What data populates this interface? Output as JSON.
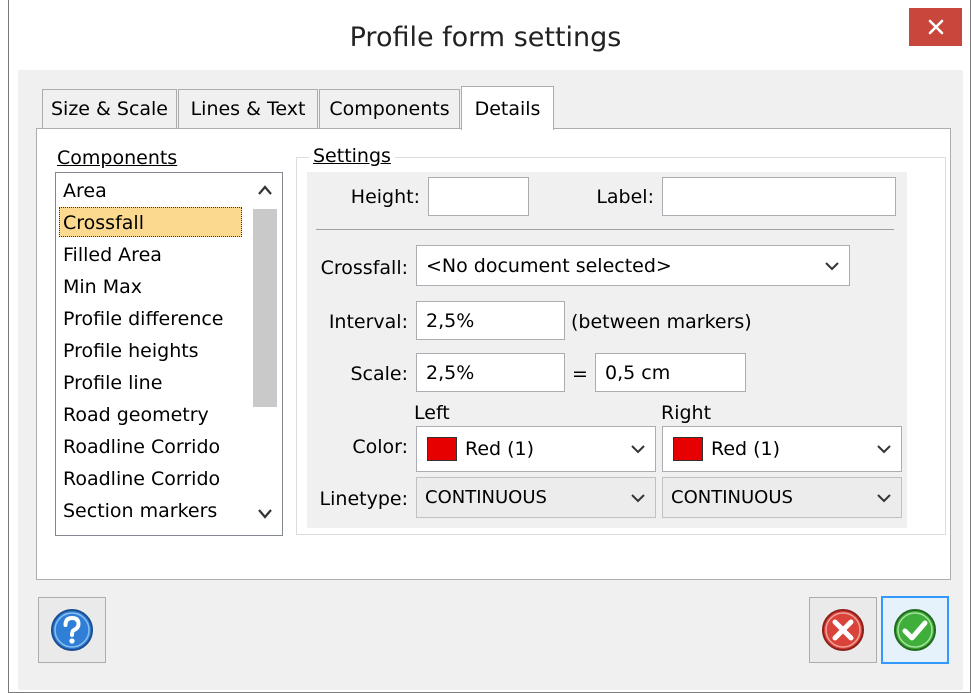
{
  "window": {
    "title": "Profile form settings"
  },
  "tabs": [
    "Size & Scale",
    "Lines & Text",
    "Components",
    "Details"
  ],
  "components": {
    "label": "Components",
    "items": [
      "Area",
      "Crossfall",
      "Filled Area",
      "Min Max",
      "Profile difference",
      "Profile heights",
      "Profile line",
      "Road geometry",
      "Roadline Corrido",
      "Roadline Corrido",
      "Section markers"
    ],
    "selected": "Crossfall"
  },
  "settings": {
    "label": "Settings",
    "height_label": "Height:",
    "height_value": "",
    "label_label": "Label:",
    "label_value": "",
    "crossfall_label": "Crossfall:",
    "crossfall_value": "<No document selected>",
    "interval_label": "Interval:",
    "interval_value": "2,5%",
    "interval_note": "(between markers)",
    "scale_label": "Scale:",
    "scale_value": "2,5%",
    "equals": "=",
    "scale_cm": "0,5 cm",
    "left_header": "Left",
    "right_header": "Right",
    "color_label": "Color:",
    "color_left": "Red (1)",
    "color_right": "Red (1)",
    "color_hex": "#e60000",
    "linetype_label": "Linetype:",
    "linetype_left": "CONTINUOUS",
    "linetype_right": "CONTINUOUS"
  },
  "buttons": {
    "help_icon": "help-icon",
    "cancel_icon": "cancel-icon",
    "ok_icon": "ok-icon"
  }
}
